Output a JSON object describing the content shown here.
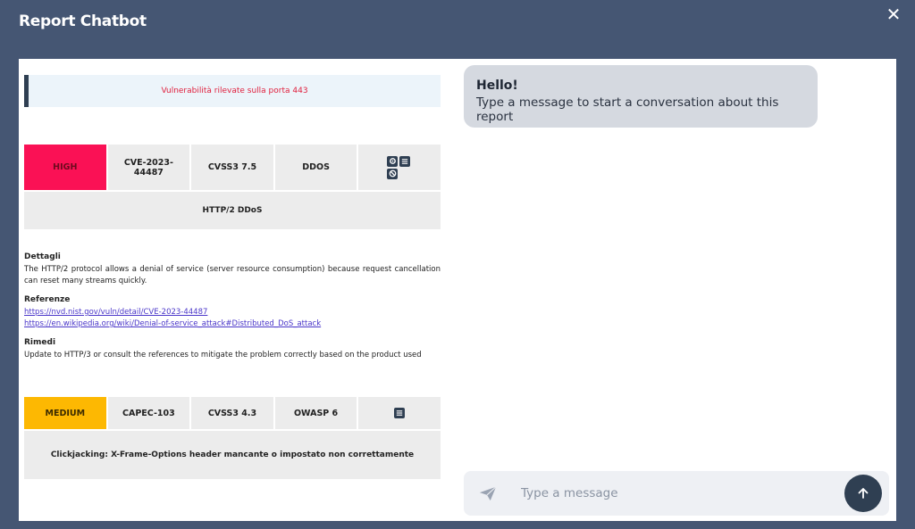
{
  "modal": {
    "title": "Report Chatbot",
    "close_label": "✕"
  },
  "report": {
    "banner": "Vulnerabilità rilevate sulla porta 443",
    "vulns": [
      {
        "severity": "HIGH",
        "cve": "CVE-2023-44487",
        "cvss": "CVSS3 7.5",
        "category": "DDOS",
        "title": "HTTP/2 DDoS",
        "icons": [
          "gear-icon",
          "list-icon",
          "block-icon"
        ]
      },
      {
        "severity": "MEDIUM",
        "capec": "CAPEC-103",
        "cvss": "CVSS3 4.3",
        "category": "OWASP 6",
        "title": "Clickjacking: X-Frame-Options header mancante o impostato non correttamente",
        "icons": [
          "list-icon"
        ]
      }
    ],
    "details": {
      "details_heading": "Dettagli",
      "details_text": "The HTTP/2 protocol allows a denial of service (server resource consumption) because request cancellation can reset many streams quickly.",
      "refs_heading": "Referenze",
      "refs": [
        "https://nvd.nist.gov/vuln/detail/CVE-2023-44487",
        "https://en.wikipedia.org/wiki/Denial-of-service_attack#Distributed_DoS_attack"
      ],
      "remedy_heading": "Rimedi",
      "remedy_text": "Update to HTTP/3 or consult the references to mitigate the problem correctly based on the product used"
    }
  },
  "chat": {
    "greeting_title": "Hello!",
    "greeting_text": "Type a message to start a conversation about this report",
    "input_placeholder": "Type a message"
  },
  "colors": {
    "backdrop": "#455673",
    "high": "#fa1155",
    "medium": "#fdb802",
    "accent": "#2f3f52",
    "banner_text": "#e01e3c"
  }
}
